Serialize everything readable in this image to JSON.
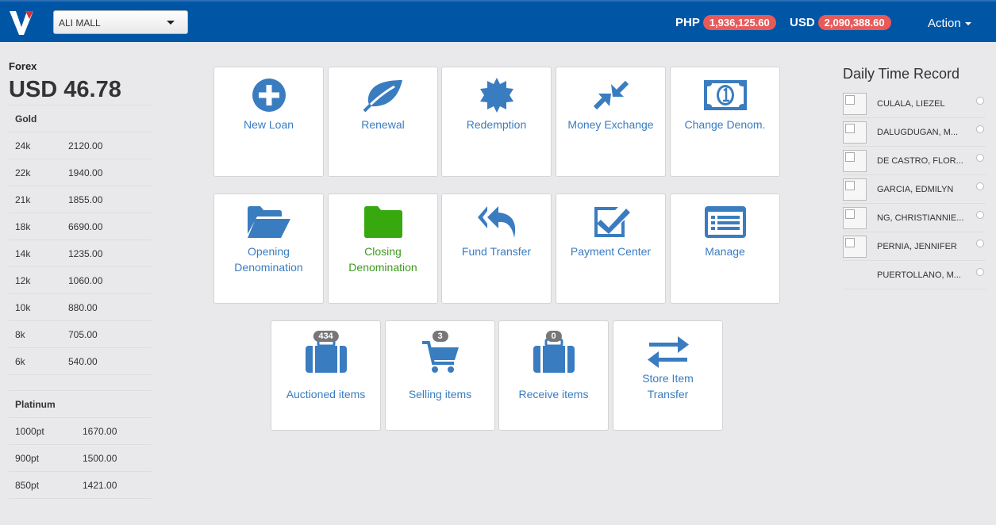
{
  "header": {
    "branch": "ALI MALL",
    "php_label": "PHP",
    "php_value": "1,936,125.60",
    "usd_label": "USD",
    "usd_value": "2,090,388.60",
    "action_label": "Action"
  },
  "forex": {
    "label": "Forex",
    "value": "USD 46.78"
  },
  "gold": {
    "title": "Gold",
    "rows": [
      {
        "k": "24k",
        "v": "2120.00"
      },
      {
        "k": "22k",
        "v": "1940.00"
      },
      {
        "k": "21k",
        "v": "1855.00"
      },
      {
        "k": "18k",
        "v": "6690.00"
      },
      {
        "k": "14k",
        "v": "1235.00"
      },
      {
        "k": "12k",
        "v": "1060.00"
      },
      {
        "k": "10k",
        "v": "880.00"
      },
      {
        "k": "8k",
        "v": "705.00"
      },
      {
        "k": "6k",
        "v": "540.00"
      }
    ]
  },
  "platinum": {
    "title": "Platinum",
    "rows": [
      {
        "k": "1000pt",
        "v": "1670.00"
      },
      {
        "k": "900pt",
        "v": "1500.00"
      },
      {
        "k": "850pt",
        "v": "1421.00"
      }
    ]
  },
  "tiles": {
    "new_loan": "New Loan",
    "renewal": "Renewal",
    "redemption": "Redemption",
    "money_exchange": "Money Exchange",
    "change_denom": "Change Denom.",
    "opening_l1": "Opening",
    "opening_l2": "Denomination",
    "closing_l1": "Closing",
    "closing_l2": "Denomination",
    "fund_transfer": "Fund Transfer",
    "payment_center": "Payment Center",
    "manage": "Manage",
    "auctioned": "Auctioned items",
    "auctioned_count": "434",
    "selling": "Selling items",
    "selling_count": "3",
    "receive": "Receive items",
    "receive_count": "0",
    "store_l1": "Store Item",
    "store_l2": "Transfer"
  },
  "dtr": {
    "title": "Daily Time Record",
    "names": [
      "CULALA, LIEZEL",
      "DALUGDUGAN, M...",
      "DE CASTRO, FLOR...",
      "GARCIA, EDMILYN",
      "NG, CHRISTIANNIE...",
      "PERNIA, JENNIFER",
      "PUERTOLLANO, M..."
    ]
  },
  "colors": {
    "header": "#0055a5",
    "accent": "#3a7cc0",
    "badge": "#e85a5a",
    "green": "#3e9a1e"
  }
}
